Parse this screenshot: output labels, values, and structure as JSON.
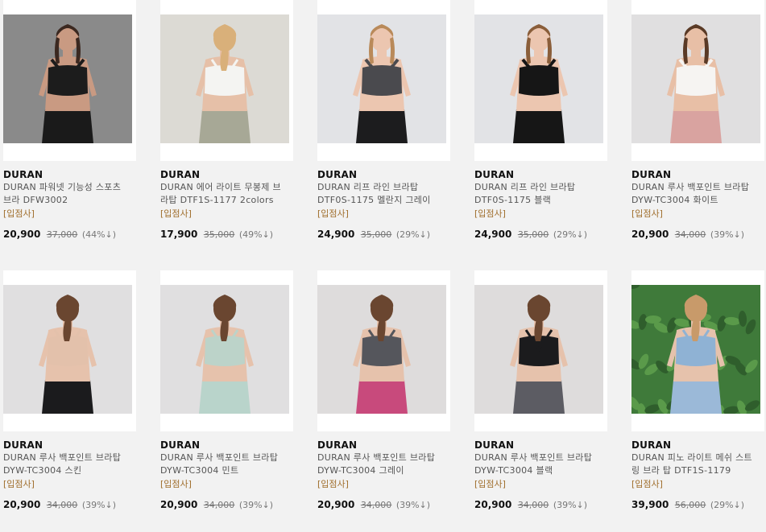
{
  "products": [
    {
      "brand": "DURAN",
      "name": "DURAN 파워넷 기능성 스포츠 브라 DFW3002",
      "tag": "[입점사]",
      "price": "20,900",
      "original_price": "37,000",
      "discount": "(44%↓)",
      "image": {
        "bg": "#8a8a8a",
        "skin": "#c99a82",
        "hair": "#3b2820",
        "top": "#1c1c1c",
        "bottom": "#1a1a1a",
        "pose": "front"
      }
    },
    {
      "brand": "DURAN",
      "name": "DURAN 에어 라이트 무봉제 브라탑 DTF1S-1177 2colors",
      "tag": "[입점사]",
      "price": "17,900",
      "original_price": "35,000",
      "discount": "(49%↓)",
      "image": {
        "bg": "#dcdad4",
        "skin": "#e6c0a8",
        "hair": "#d9b07a",
        "top": "#f4f4f2",
        "bottom": "#a7a896",
        "pose": "back"
      }
    },
    {
      "brand": "DURAN",
      "name": "DURAN 리프 라인 브라탑 DTF0S-1175 멜란지 그레이",
      "tag": "[입점사]",
      "price": "24,900",
      "original_price": "35,000",
      "discount": "(29%↓)",
      "image": {
        "bg": "#e2e3e6",
        "skin": "#ecc6b0",
        "hair": "#b98a5a",
        "top": "#4a4a4e",
        "bottom": "#1c1c1e",
        "pose": "front"
      }
    },
    {
      "brand": "DURAN",
      "name": "DURAN 리프 라인 브라탑 DTF0S-1175 블랙",
      "tag": "[입점사]",
      "price": "24,900",
      "original_price": "35,000",
      "discount": "(29%↓)",
      "image": {
        "bg": "#e2e3e6",
        "skin": "#ecc6b0",
        "hair": "#8a5e3a",
        "top": "#161616",
        "bottom": "#161616",
        "pose": "side"
      }
    },
    {
      "brand": "DURAN",
      "name": "DURAN 루사 백포인트 브라탑 DYW-TC3004 화이트",
      "tag": "[입점사]",
      "price": "20,900",
      "original_price": "34,000",
      "discount": "(39%↓)",
      "image": {
        "bg": "#e0dfe0",
        "skin": "#e8bfa6",
        "hair": "#5a3a26",
        "top": "#f6f4f2",
        "bottom": "#d9a3a0",
        "pose": "side"
      }
    },
    {
      "brand": "DURAN",
      "name": "DURAN 루사 백포인트 브라탑 DYW-TC3004 스킨",
      "tag": "[입점사]",
      "price": "20,900",
      "original_price": "34,000",
      "discount": "(39%↓)",
      "image": {
        "bg": "#e0dfe0",
        "skin": "#e6c2ac",
        "hair": "#6a4630",
        "top": "#e3c1ab",
        "bottom": "#1b1b1d",
        "pose": "back"
      }
    },
    {
      "brand": "DURAN",
      "name": "DURAN 루사 백포인트 브라탑 DYW-TC3004 민트",
      "tag": "[입점사]",
      "price": "20,900",
      "original_price": "34,000",
      "discount": "(39%↓)",
      "image": {
        "bg": "#e0dfe0",
        "skin": "#e6c2ac",
        "hair": "#6a4630",
        "top": "#bcd3c9",
        "bottom": "#b9d4cb",
        "pose": "back"
      }
    },
    {
      "brand": "DURAN",
      "name": "DURAN 루사 백포인트 브라탑 DYW-TC3004 그레이",
      "tag": "[입점사]",
      "price": "20,900",
      "original_price": "34,000",
      "discount": "(39%↓)",
      "image": {
        "bg": "#dedcdc",
        "skin": "#e6c2ac",
        "hair": "#6a4630",
        "top": "#55565c",
        "bottom": "#c84a7c",
        "pose": "back"
      }
    },
    {
      "brand": "DURAN",
      "name": "DURAN 루사 백포인트 브라탑 DYW-TC3004 블랙",
      "tag": "[입점사]",
      "price": "20,900",
      "original_price": "34,000",
      "discount": "(39%↓)",
      "image": {
        "bg": "#dedcdc",
        "skin": "#e6c2ac",
        "hair": "#6a4630",
        "top": "#1b1b1d",
        "bottom": "#5c5c63",
        "pose": "back"
      }
    },
    {
      "brand": "DURAN",
      "name": "DURAN 피노 라이트 메쉬 스트링 브라 탑 DTF1S-1179",
      "tag": "[입점사]",
      "price": "39,900",
      "original_price": "56,000",
      "discount": "(29%↓)",
      "image": {
        "bg": "#3f7a3a",
        "skin": "#e6c2ac",
        "hair": "#c89a6a",
        "top": "#8fb2d4",
        "bottom": "#9bb9d8",
        "pose": "back"
      }
    }
  ]
}
